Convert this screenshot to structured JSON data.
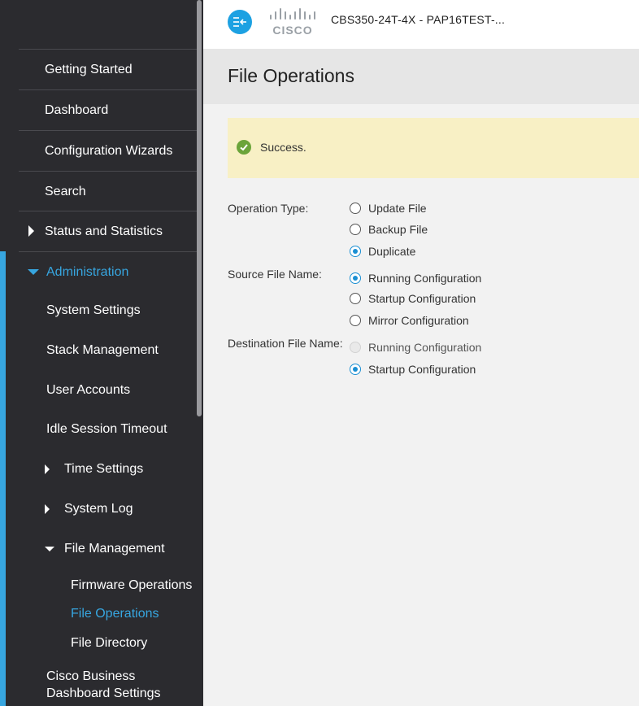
{
  "header": {
    "device_title": "CBS350-24T-4X - PAP16TEST-...",
    "logo_text": "CISCO",
    "brand_color": "#1da1e2"
  },
  "sidebar": {
    "top_items": [
      {
        "label": "Getting Started"
      },
      {
        "label": "Dashboard"
      },
      {
        "label": "Configuration Wizards"
      },
      {
        "label": "Search"
      },
      {
        "label": "Status and Statistics",
        "collapsed": true
      }
    ],
    "admin": {
      "label": "Administration",
      "expanded": true,
      "items": [
        {
          "label": "System Settings"
        },
        {
          "label": "Stack Management"
        },
        {
          "label": "User Accounts"
        },
        {
          "label": "Idle Session Timeout"
        },
        {
          "label": "Time Settings",
          "collapsed": true
        },
        {
          "label": "System Log",
          "collapsed": true
        },
        {
          "label": "File Management",
          "expanded": true
        }
      ],
      "file_management_items": [
        {
          "label": "Firmware Operations"
        },
        {
          "label": "File Operations",
          "active": true
        },
        {
          "label": "File Directory"
        }
      ],
      "cbd_settings": {
        "line1": "Cisco Business",
        "line2": "Dashboard Settings"
      }
    },
    "accent_color": "#37a6e0"
  },
  "page": {
    "title": "File Operations",
    "success_message": "Success."
  },
  "form": {
    "operation_type": {
      "label": "Operation Type:",
      "options": [
        {
          "label": "Update File",
          "checked": false
        },
        {
          "label": "Backup File",
          "checked": false
        },
        {
          "label": "Duplicate",
          "checked": true
        }
      ]
    },
    "source_file": {
      "label": "Source File Name:",
      "options": [
        {
          "label": "Running Configuration",
          "checked": true
        },
        {
          "label": "Startup Configuration",
          "checked": false
        },
        {
          "label": "Mirror Configuration",
          "checked": false
        }
      ]
    },
    "destination_file": {
      "label": "Destination File Name:",
      "options": [
        {
          "label": "Running Configuration",
          "checked": false,
          "disabled": true
        },
        {
          "label": "Startup Configuration",
          "checked": true
        }
      ]
    }
  }
}
